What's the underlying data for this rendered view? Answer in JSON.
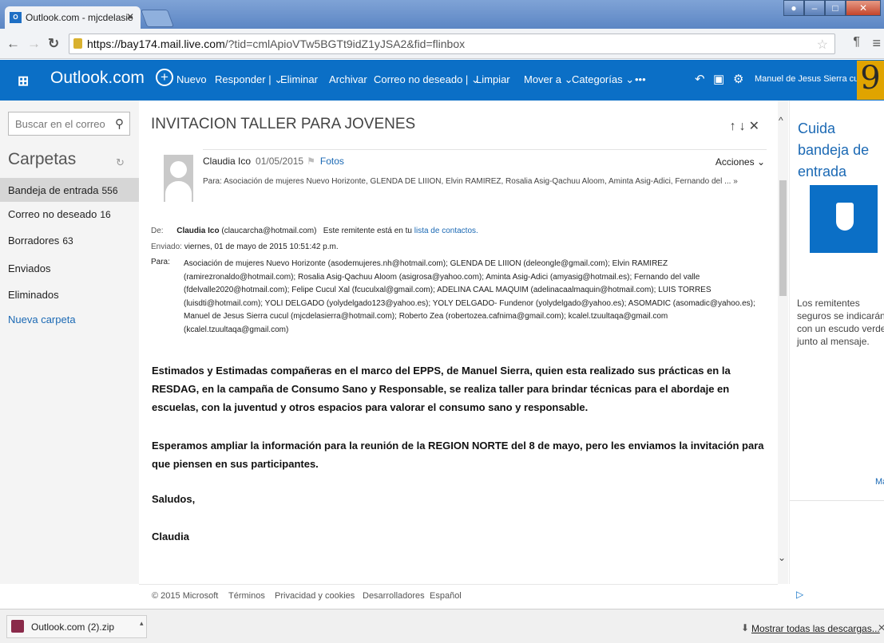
{
  "browser": {
    "tab_title": "Outlook.com - mjcdelasie",
    "url_host": "https://bay174.mail.live.com",
    "url_rest": "/?tid=cmlApioVTw5BGTt9idZ1yJSA2&fid=flinbox"
  },
  "topbar": {
    "brand": "Outlook.com",
    "new_label": "Nuevo",
    "reply_label": "Responder",
    "delete_label": "Eliminar",
    "archive_label": "Archivar",
    "junk_label": "Correo no deseado",
    "clean_label": "Limpiar",
    "move_label": "Mover a",
    "categories_label": "Categorías",
    "more_label": "•••",
    "user_name": "Manuel de Jesus Sierra cucul"
  },
  "sidebar": {
    "search_placeholder": "Buscar en el correo",
    "folders_title": "Carpetas",
    "folders": [
      {
        "label": "Bandeja de entrada",
        "count": "556"
      },
      {
        "label": "Correo no deseado",
        "count": "16"
      },
      {
        "label": "Borradores",
        "count": "63"
      },
      {
        "label": "Enviados",
        "count": ""
      },
      {
        "label": "Eliminados",
        "count": ""
      }
    ],
    "new_folder": "Nueva carpeta"
  },
  "message": {
    "subject": "INVITACION TALLER PARA JOVENES",
    "sender": "Claudia Ico",
    "date": "01/05/2015",
    "fotos": "Fotos",
    "acciones": "Acciones",
    "to_summary": "Para: Asociación de mujeres Nuevo Horizonte, GLENDA DE LIIION, Elvin RAMIREZ, Rosalia Asig-Qachuu Aloom, Aminta Asig-Adici, Fernando del ...",
    "de_label": "De:",
    "de_name": "Claudia Ico",
    "de_email": "(claucarcha@hotmail.com)",
    "contact_note": "Este remitente está en tu",
    "contact_link": "lista de contactos.",
    "sent_label": "Enviado:",
    "sent_value": "viernes, 01 de mayo de 2015 10:51:42 p.m.",
    "para_label": "Para:",
    "recipients": "Asociación de mujeres Nuevo Horizonte (asodemujeres.nh@hotmail.com); GLENDA DE LIIION (deleongle@gmail.com); Elvin RAMIREZ (ramirezronaldo@hotmail.com); Rosalia Asig-Qachuu Aloom (asigrosa@yahoo.com); Aminta Asig-Adici (amyasig@hotmail.es); Fernando del valle (fdelvalle2020@hotmail.com); Felipe Cucul Xal (fcuculxal@gmail.com); ADELINA CAAL MAQUIM (adelinacaalmaquin@hotmail.com); LUIS TORRES (luisdti@hotmail.com); YOLI DELGADO (yolydelgado123@yahoo.es); YOLY DELGADO- Fundenor (yolydelgado@yahoo.es); ASOMADIC (asomadic@yahoo.es); Manuel de Jesus Sierra cucul (mjcdelasierra@hotmail.com); Roberto Zea (robertozea.cafnima@gmail.com); kcalel.tzuultaqa@gmail.com (kcalel.tzuultaqa@gmail.com)",
    "body_p1": "Estimados y Estimadas compañeras en el marco del EPPS, de Manuel Sierra, quien esta realizado sus prácticas en la RESDAG, en la campaña de Consumo Sano y Responsable, se realiza taller para brindar técnicas para el abordaje en escuelas, con la juventud y otros espacios para valorar el consumo sano y responsable.",
    "body_p2": "Esperamos ampliar la información  para la reunión de la REGION NORTE del 8 de mayo, pero les enviamos la invitación para que piensen en sus participantes.",
    "body_p3": "Saludos,",
    "body_p4": "Claudia"
  },
  "right_panel": {
    "title": "Cuida bandeja de entrada",
    "text": "Los remitentes seguros se indicarán con un escudo verde junto al mensaje.",
    "more": "Má"
  },
  "footer": {
    "copyright": "© 2015 Microsoft",
    "terms": "Términos",
    "privacy": "Privacidad y cookies",
    "developers": "Desarrolladores",
    "language": "Español"
  },
  "downloads": {
    "file": "Outlook.com (2).zip",
    "show_all": "Mostrar todas las descargas..."
  },
  "colors": {
    "accent": "#0b6fc6",
    "link": "#1b69b4",
    "sidebar_bg": "#f4f4f4",
    "active_folder": "#d6d6d6"
  }
}
